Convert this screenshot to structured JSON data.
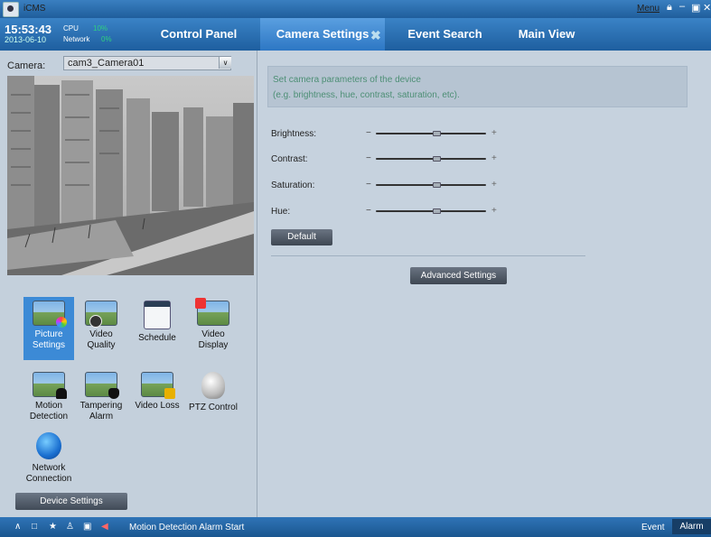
{
  "titlebar": {
    "app_title": "iCMS",
    "menu_label": "Menu",
    "icons": [
      "lock-icon",
      "minimize-icon",
      "restore-icon",
      "close-icon"
    ]
  },
  "header": {
    "time": "15:53:43",
    "date": "2013-06-10",
    "cpu_label": "CPU",
    "cpu_value": "10%",
    "network_label": "Network",
    "network_value": "0%"
  },
  "tabs": [
    {
      "label": "Control Panel"
    },
    {
      "label": "Camera Settings",
      "active": true
    },
    {
      "label": "Event Search"
    },
    {
      "label": "Main View"
    }
  ],
  "left_panel": {
    "camera_label": "Camera:",
    "camera_selected": "cam3_Camera01",
    "items": [
      {
        "label": "Picture Settings",
        "icon": "picture-settings-icon",
        "selected": true
      },
      {
        "label": "Video Quality",
        "icon": "video-quality-icon"
      },
      {
        "label": "Schedule",
        "icon": "schedule-icon"
      },
      {
        "label": "Video Display",
        "icon": "video-display-icon"
      },
      {
        "label": "Motion Detection",
        "icon": "motion-detection-icon"
      },
      {
        "label": "Tampering Alarm",
        "icon": "tampering-alarm-icon"
      },
      {
        "label": "Video Loss",
        "icon": "video-loss-icon"
      },
      {
        "label": "PTZ Control",
        "icon": "ptz-control-icon"
      },
      {
        "label": "Network Connection",
        "icon": "network-connection-icon"
      }
    ],
    "device_settings_label": "Device Settings"
  },
  "right_panel": {
    "info_line1": "Set camera parameters of the device",
    "info_line2": "(e.g. brightness, hue, contrast, saturation, etc).",
    "sliders": [
      {
        "label": "Brightness:",
        "value": 0.55
      },
      {
        "label": "Contrast:",
        "value": 0.55
      },
      {
        "label": "Saturation:",
        "value": 0.55
      },
      {
        "label": "Hue:",
        "value": 0.55
      }
    ],
    "minus": "−",
    "plus": "+",
    "default_label": "Default",
    "advanced_label": "Advanced Settings"
  },
  "statusbar": {
    "message": "Motion Detection Alarm Start",
    "event_label": "Event",
    "alarm_label": "Alarm"
  },
  "colors": {
    "accent": "#3c8ad6",
    "titlebar": "#1f5e9c",
    "info_text": "#4d8f75"
  }
}
